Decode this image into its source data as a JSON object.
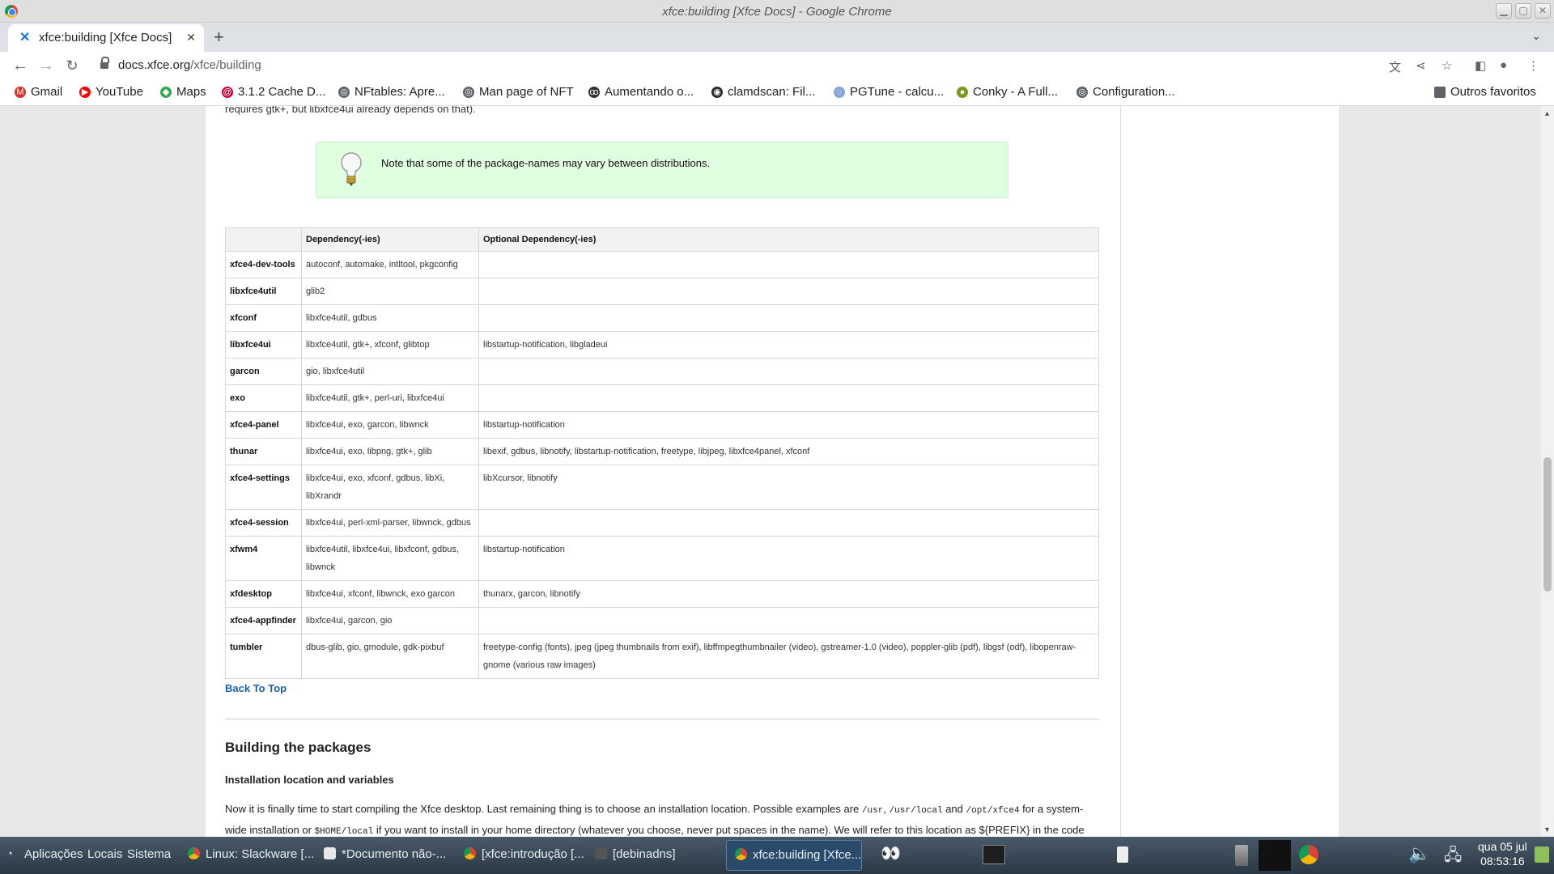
{
  "window": {
    "title": "xfce:building [Xfce Docs] - Google Chrome"
  },
  "tab": {
    "label": "xfce:building [Xfce Docs]",
    "favicon": "xfce-icon"
  },
  "toolbar": {
    "url_host": "docs.xfce.org",
    "url_path": "/xfce/building"
  },
  "bookmarks": [
    {
      "label": "Gmail",
      "icon": "gmail-icon",
      "color": "#d93025"
    },
    {
      "label": "YouTube",
      "icon": "youtube-icon",
      "color": "#ff0000"
    },
    {
      "label": "Maps",
      "icon": "maps-icon",
      "color": "#34a853"
    },
    {
      "label": "3.1.2 Cache D...",
      "icon": "debian-icon",
      "color": "#c70036"
    },
    {
      "label": "NFtables: Apre...",
      "icon": "globe-icon",
      "color": "#5f6368"
    },
    {
      "label": "Man page of NFT",
      "icon": "globe-icon",
      "color": "#5f6368"
    },
    {
      "label": "Aumentando o...",
      "icon": "tux-icon",
      "color": "#333333"
    },
    {
      "label": "clamdscan: Fil...",
      "icon": "github-icon",
      "color": "#24292e"
    },
    {
      "label": "PGTune - calcu...",
      "icon": "pgtune-icon",
      "color": "#8aa4d6"
    },
    {
      "label": "Conky - A Full...",
      "icon": "conky-icon",
      "color": "#7a9a1a"
    },
    {
      "label": "Configuration...",
      "icon": "globe-icon",
      "color": "#5f6368"
    }
  ],
  "bookmarks_other": "Outros favoritos",
  "page": {
    "top_text": "requires gtk+, but libxfce4ui already depends on that).",
    "note": "Note that some of the package-names may vary between distributions.",
    "table": {
      "headers": [
        "",
        "Dependency(-ies)",
        "Optional Dependency(-ies)"
      ],
      "rows": [
        {
          "pkg": "xfce4-dev-tools",
          "dep": "autoconf, automake, intltool, pkgconfig",
          "opt": ""
        },
        {
          "pkg": "libxfce4util",
          "dep": "glib2",
          "opt": ""
        },
        {
          "pkg": "xfconf",
          "dep": "libxfce4util, gdbus",
          "opt": ""
        },
        {
          "pkg": "libxfce4ui",
          "dep": "libxfce4util, gtk+, xfconf, glibtop",
          "opt": "libstartup-notification, libgladeui"
        },
        {
          "pkg": "garcon",
          "dep": "gio, libxfce4util",
          "opt": ""
        },
        {
          "pkg": "exo",
          "dep": "libxfce4util, gtk+, perl-uri, libxfce4ui",
          "opt": ""
        },
        {
          "pkg": "xfce4-panel",
          "dep": "libxfce4ui, exo, garcon, libwnck",
          "opt": "libstartup-notification"
        },
        {
          "pkg": "thunar",
          "dep": "libxfce4ui, exo, libpng, gtk+, glib",
          "opt": "libexif, gdbus, libnotify, libstartup-notification, freetype, libjpeg, libxfce4panel, xfconf"
        },
        {
          "pkg": "xfce4-settings",
          "dep": "libxfce4ui, exo, xfconf, gdbus, libXi, libXrandr",
          "opt": "libXcursor, libnotify"
        },
        {
          "pkg": "xfce4-session",
          "dep": "libxfce4ui, perl-xml-parser, libwnck, gdbus",
          "opt": ""
        },
        {
          "pkg": "xfwm4",
          "dep": "libxfce4util, libxfce4ui, libxfconf, gdbus, libwnck",
          "opt": "libstartup-notification"
        },
        {
          "pkg": "xfdesktop",
          "dep": "libxfce4ui, xfconf, libwnck, exo garcon",
          "opt": "thunarx, garcon, libnotify"
        },
        {
          "pkg": "xfce4-appfinder",
          "dep": "libxfce4ui, garcon, gio",
          "opt": ""
        },
        {
          "pkg": "tumbler",
          "dep": "dbus-glib, gio, gmodule, gdk-pixbuf",
          "opt": "freetype-config (fonts), jpeg (jpeg thumbnails from exif), libffmpegthumbnailer (video), gstreamer-1.0 (video), poppler-glib (pdf), libgsf (odf), libopenraw-gnome (various raw images)"
        }
      ]
    },
    "back_to_top": "Back To Top",
    "heading": "Building the packages",
    "subheading": "Installation location and variables",
    "para_1": "Now it is finally time to start compiling the Xfce desktop. Last remaining thing is to choose an installation location. Possible examples are",
    "code_usr": "/usr",
    "code_usr_local": "/usr/local",
    "para_and": "and",
    "code_opt": "/opt/xfce4",
    "para_2": "for a system-wide installation or",
    "code_home": "$HOME/local",
    "para_3": "if you want to install in your home directory (whatever you choose, never put spaces in the name). We will refer to this location as ${PREFIX} in the code examples"
  },
  "taskbar": {
    "menu": [
      "Aplicações",
      "Locais",
      "Sistema"
    ],
    "tasks": [
      {
        "label": "Linux: Slackware [...",
        "icon": "chrome-icon",
        "active": false
      },
      {
        "label": "*Documento não-...",
        "icon": "text-editor-icon",
        "active": false
      },
      {
        "label": "[xfce:introdução [...",
        "icon": "chrome-icon",
        "active": false
      },
      {
        "label": "[debinadns]",
        "icon": "terminal-icon",
        "active": false
      },
      {
        "label": "xfce:building [Xfce...",
        "icon": "chrome-icon",
        "active": true
      }
    ],
    "clock_date": "qua 05 jul",
    "clock_time": "08:53:16"
  }
}
